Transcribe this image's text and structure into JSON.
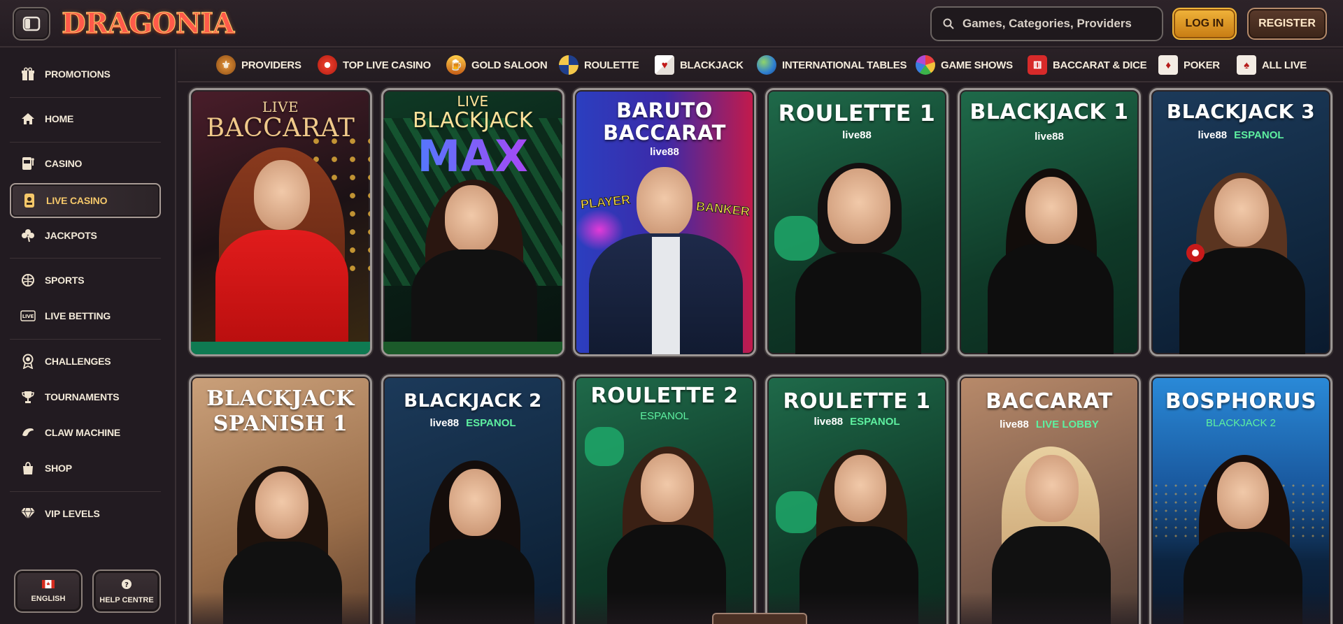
{
  "header": {
    "logo_text": "DRAGONIA",
    "search_placeholder": "Games, Categories, Providers",
    "login_label": "LOG IN",
    "register_label": "REGISTER"
  },
  "sidebar": {
    "items": [
      {
        "label": "PROMOTIONS",
        "icon": "gift-icon"
      },
      {
        "label": "HOME",
        "icon": "home-icon"
      },
      {
        "label": "CASINO",
        "icon": "slot-machine-icon"
      },
      {
        "label": "LIVE CASINO",
        "icon": "live-casino-icon",
        "active": true
      },
      {
        "label": "JACKPOTS",
        "icon": "clover-icon"
      },
      {
        "label": "SPORTS",
        "icon": "ball-icon"
      },
      {
        "label": "LIVE BETTING",
        "icon": "live-badge-icon"
      },
      {
        "label": "CHALLENGES",
        "icon": "badge-icon"
      },
      {
        "label": "TOURNAMENTS",
        "icon": "trophy-icon"
      },
      {
        "label": "CLAW MACHINE",
        "icon": "claw-icon"
      },
      {
        "label": "SHOP",
        "icon": "bag-icon"
      },
      {
        "label": "VIP LEVELS",
        "icon": "diamond-icon"
      }
    ],
    "footer": {
      "language_label": "ENGLISH",
      "help_label": "HELP CENTRE"
    }
  },
  "categories": [
    {
      "label": "PROVIDERS",
      "icon": "providers-icon"
    },
    {
      "label": "TOP LIVE CASINO",
      "icon": "poker-chip-icon"
    },
    {
      "label": "GOLD SALOON",
      "icon": "saloon-icon"
    },
    {
      "label": "ROULETTE",
      "icon": "roulette-icon"
    },
    {
      "label": "BLACKJACK",
      "icon": "cards-icon"
    },
    {
      "label": "INTERNATIONAL TABLES",
      "icon": "globe-icon"
    },
    {
      "label": "GAME SHOWS",
      "icon": "wheel-icon"
    },
    {
      "label": "BACCARAT & DICE",
      "icon": "dice-icon"
    },
    {
      "label": "POKER",
      "icon": "poker-cards-icon"
    },
    {
      "label": "ALL LIVE",
      "icon": "all-live-icon"
    }
  ],
  "games": [
    {
      "title_small": "LIVE",
      "title": "BACCARAT",
      "sub": "",
      "lang": "",
      "theme": "baccarat"
    },
    {
      "title_small": "LIVE",
      "title": "BLACKJACK",
      "title2": "MAX",
      "sub": "",
      "lang": "",
      "theme": "bjmax"
    },
    {
      "title": "BARUTO",
      "title2": "BACCARAT",
      "sub": "live88",
      "lang": "",
      "player": "PLAYER",
      "banker": "BANKER",
      "theme": "baruto"
    },
    {
      "title": "ROULETTE 1",
      "sub": "live88",
      "lang": "",
      "theme": "green"
    },
    {
      "title": "BLACKJACK 1",
      "sub": "live88",
      "lang": "",
      "theme": "green"
    },
    {
      "title": "BLACKJACK 3",
      "sub": "live88",
      "lang": "ESPANOL",
      "theme": "blue"
    },
    {
      "title": "BLACKJACK",
      "title2": "SPANISH 1",
      "sub": "",
      "lang": "",
      "theme": "beige"
    },
    {
      "title": "BLACKJACK 2",
      "sub": "live88",
      "lang": "ESPANOL",
      "theme": "blue"
    },
    {
      "title": "ROULETTE 2",
      "sub": "",
      "lang": "ESPANOL",
      "theme": "green"
    },
    {
      "title": "ROULETTE 1",
      "sub": "live88",
      "lang": "ESPANOL",
      "theme": "green"
    },
    {
      "title": "BACCARAT",
      "sub": "live88",
      "lang": "LIVE LOBBY",
      "theme": "tan"
    },
    {
      "title": "BOSPHORUS",
      "sub": "",
      "lang": "BLACKJACK 2",
      "theme": "sky"
    }
  ]
}
